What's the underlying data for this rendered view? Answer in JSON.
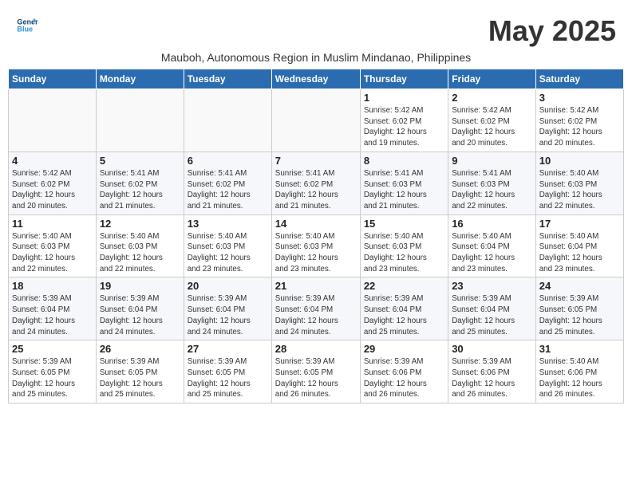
{
  "header": {
    "logo_line1": "General",
    "logo_line2": "Blue",
    "month_title": "May 2025",
    "subtitle": "Mauboh, Autonomous Region in Muslim Mindanao, Philippines"
  },
  "weekdays": [
    "Sunday",
    "Monday",
    "Tuesday",
    "Wednesday",
    "Thursday",
    "Friday",
    "Saturday"
  ],
  "weeks": [
    [
      {
        "day": "",
        "info": ""
      },
      {
        "day": "",
        "info": ""
      },
      {
        "day": "",
        "info": ""
      },
      {
        "day": "",
        "info": ""
      },
      {
        "day": "1",
        "info": "Sunrise: 5:42 AM\nSunset: 6:02 PM\nDaylight: 12 hours\nand 19 minutes."
      },
      {
        "day": "2",
        "info": "Sunrise: 5:42 AM\nSunset: 6:02 PM\nDaylight: 12 hours\nand 20 minutes."
      },
      {
        "day": "3",
        "info": "Sunrise: 5:42 AM\nSunset: 6:02 PM\nDaylight: 12 hours\nand 20 minutes."
      }
    ],
    [
      {
        "day": "4",
        "info": "Sunrise: 5:42 AM\nSunset: 6:02 PM\nDaylight: 12 hours\nand 20 minutes."
      },
      {
        "day": "5",
        "info": "Sunrise: 5:41 AM\nSunset: 6:02 PM\nDaylight: 12 hours\nand 21 minutes."
      },
      {
        "day": "6",
        "info": "Sunrise: 5:41 AM\nSunset: 6:02 PM\nDaylight: 12 hours\nand 21 minutes."
      },
      {
        "day": "7",
        "info": "Sunrise: 5:41 AM\nSunset: 6:02 PM\nDaylight: 12 hours\nand 21 minutes."
      },
      {
        "day": "8",
        "info": "Sunrise: 5:41 AM\nSunset: 6:03 PM\nDaylight: 12 hours\nand 21 minutes."
      },
      {
        "day": "9",
        "info": "Sunrise: 5:41 AM\nSunset: 6:03 PM\nDaylight: 12 hours\nand 22 minutes."
      },
      {
        "day": "10",
        "info": "Sunrise: 5:40 AM\nSunset: 6:03 PM\nDaylight: 12 hours\nand 22 minutes."
      }
    ],
    [
      {
        "day": "11",
        "info": "Sunrise: 5:40 AM\nSunset: 6:03 PM\nDaylight: 12 hours\nand 22 minutes."
      },
      {
        "day": "12",
        "info": "Sunrise: 5:40 AM\nSunset: 6:03 PM\nDaylight: 12 hours\nand 22 minutes."
      },
      {
        "day": "13",
        "info": "Sunrise: 5:40 AM\nSunset: 6:03 PM\nDaylight: 12 hours\nand 23 minutes."
      },
      {
        "day": "14",
        "info": "Sunrise: 5:40 AM\nSunset: 6:03 PM\nDaylight: 12 hours\nand 23 minutes."
      },
      {
        "day": "15",
        "info": "Sunrise: 5:40 AM\nSunset: 6:03 PM\nDaylight: 12 hours\nand 23 minutes."
      },
      {
        "day": "16",
        "info": "Sunrise: 5:40 AM\nSunset: 6:04 PM\nDaylight: 12 hours\nand 23 minutes."
      },
      {
        "day": "17",
        "info": "Sunrise: 5:40 AM\nSunset: 6:04 PM\nDaylight: 12 hours\nand 23 minutes."
      }
    ],
    [
      {
        "day": "18",
        "info": "Sunrise: 5:39 AM\nSunset: 6:04 PM\nDaylight: 12 hours\nand 24 minutes."
      },
      {
        "day": "19",
        "info": "Sunrise: 5:39 AM\nSunset: 6:04 PM\nDaylight: 12 hours\nand 24 minutes."
      },
      {
        "day": "20",
        "info": "Sunrise: 5:39 AM\nSunset: 6:04 PM\nDaylight: 12 hours\nand 24 minutes."
      },
      {
        "day": "21",
        "info": "Sunrise: 5:39 AM\nSunset: 6:04 PM\nDaylight: 12 hours\nand 24 minutes."
      },
      {
        "day": "22",
        "info": "Sunrise: 5:39 AM\nSunset: 6:04 PM\nDaylight: 12 hours\nand 25 minutes."
      },
      {
        "day": "23",
        "info": "Sunrise: 5:39 AM\nSunset: 6:04 PM\nDaylight: 12 hours\nand 25 minutes."
      },
      {
        "day": "24",
        "info": "Sunrise: 5:39 AM\nSunset: 6:05 PM\nDaylight: 12 hours\nand 25 minutes."
      }
    ],
    [
      {
        "day": "25",
        "info": "Sunrise: 5:39 AM\nSunset: 6:05 PM\nDaylight: 12 hours\nand 25 minutes."
      },
      {
        "day": "26",
        "info": "Sunrise: 5:39 AM\nSunset: 6:05 PM\nDaylight: 12 hours\nand 25 minutes."
      },
      {
        "day": "27",
        "info": "Sunrise: 5:39 AM\nSunset: 6:05 PM\nDaylight: 12 hours\nand 25 minutes."
      },
      {
        "day": "28",
        "info": "Sunrise: 5:39 AM\nSunset: 6:05 PM\nDaylight: 12 hours\nand 26 minutes."
      },
      {
        "day": "29",
        "info": "Sunrise: 5:39 AM\nSunset: 6:06 PM\nDaylight: 12 hours\nand 26 minutes."
      },
      {
        "day": "30",
        "info": "Sunrise: 5:39 AM\nSunset: 6:06 PM\nDaylight: 12 hours\nand 26 minutes."
      },
      {
        "day": "31",
        "info": "Sunrise: 5:40 AM\nSunset: 6:06 PM\nDaylight: 12 hours\nand 26 minutes."
      }
    ]
  ]
}
